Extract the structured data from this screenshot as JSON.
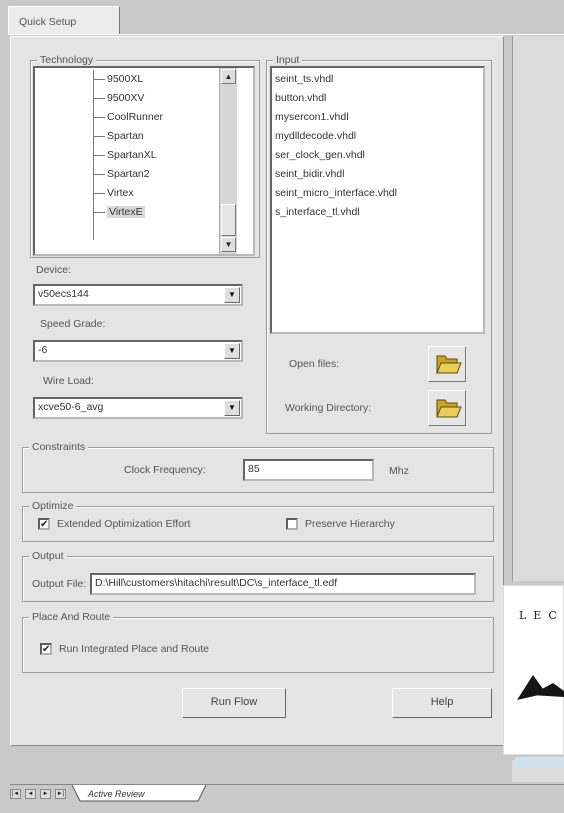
{
  "tab": {
    "label": "Quick Setup"
  },
  "technology": {
    "title": "Technology",
    "items": [
      "9500XL",
      "9500XV",
      "CoolRunner",
      "Spartan",
      "SpartanXL",
      "Spartan2",
      "Virtex",
      "VirtexE"
    ],
    "selected": "VirtexE"
  },
  "input": {
    "title": "Input",
    "files": [
      "seint_ts.vhdl",
      "button.vhdl",
      "mysercon1.vhdl",
      "mydlldecode.vhdl",
      "ser_clock_gen.vhdl",
      "seint_bidir.vhdl",
      "seint_micro_interface.vhdl",
      "s_interface_tl.vhdl"
    ],
    "open_files_label": "Open files:",
    "working_directory_label": "Working Directory:"
  },
  "device": {
    "label": "Device:",
    "value": "v50ecs144"
  },
  "speed_grade": {
    "label": "Speed Grade:",
    "value": "-6"
  },
  "wire_load": {
    "label": "Wire Load:",
    "value": "xcve50-6_avg"
  },
  "constraints": {
    "title": "Constraints",
    "clock_label": "Clock Frequency:",
    "clock_value": "85",
    "unit": "Mhz"
  },
  "optimize": {
    "title": "Optimize",
    "extended_label": "Extended Optimization Effort",
    "extended_checked": true,
    "preserve_label": "Preserve Hierarchy",
    "preserve_checked": false
  },
  "output": {
    "title": "Output",
    "file_label": "Output File:",
    "file_value": "D:\\Hill\\customers\\hitachi\\result\\DC\\s_interface_tl.edf"
  },
  "place_route": {
    "title": "Place And Route",
    "run_label": "Run Integrated Place and Route",
    "run_checked": true
  },
  "buttons": {
    "run_flow": "Run Flow",
    "help": "Help"
  },
  "bottom_tabs": {
    "active_review": "Active Review"
  },
  "logo": {
    "text": "LEC"
  },
  "icons": {
    "checkmark": "✔",
    "arrow_down": "▼",
    "arrow_up": "▲",
    "first": "|◄",
    "prev": "◄",
    "next": "►",
    "last": "►|"
  }
}
